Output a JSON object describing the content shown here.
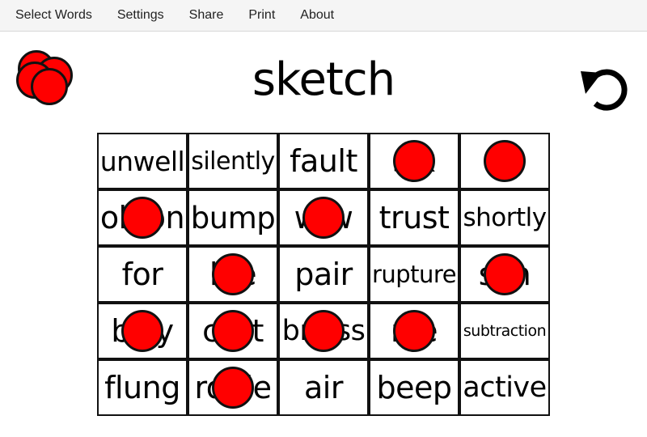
{
  "menu": {
    "items": [
      {
        "label": "Select Words"
      },
      {
        "label": "Settings"
      },
      {
        "label": "Share"
      },
      {
        "label": "Print"
      },
      {
        "label": "About"
      }
    ]
  },
  "title": "sketch",
  "colors": {
    "marker": "#ff0000",
    "outline": "#111111"
  },
  "icons": {
    "undo": "undo-icon",
    "chips": "marker-chips-icon"
  },
  "board": {
    "rows": [
      [
        {
          "word": "unwell",
          "marked": false
        },
        {
          "word": "silently",
          "marked": false
        },
        {
          "word": "fault",
          "marked": false
        },
        {
          "word": "s  x",
          "marked": true
        },
        {
          "word": "",
          "marked": true
        }
      ],
      [
        {
          "word": "ob    on",
          "marked": true
        },
        {
          "word": "bump",
          "marked": false
        },
        {
          "word": "w    w",
          "marked": true
        },
        {
          "word": "trust",
          "marked": false
        },
        {
          "word": "shortly",
          "marked": false
        }
      ],
      [
        {
          "word": "for",
          "marked": false
        },
        {
          "word": "b    e",
          "marked": true
        },
        {
          "word": "pair",
          "marked": false
        },
        {
          "word": "rupture",
          "marked": false
        },
        {
          "word": "sl    h",
          "marked": true
        }
      ],
      [
        {
          "word": "bi      ly",
          "marked": true
        },
        {
          "word": "cl    st",
          "marked": true
        },
        {
          "word": "br      ess",
          "marked": true
        },
        {
          "word": "n    e",
          "marked": true
        },
        {
          "word": "subtraction",
          "marked": false
        }
      ],
      [
        {
          "word": "flung",
          "marked": false
        },
        {
          "word": "ro    de",
          "marked": true
        },
        {
          "word": "air",
          "marked": false
        },
        {
          "word": "beep",
          "marked": false
        },
        {
          "word": "active",
          "marked": false
        }
      ]
    ]
  }
}
